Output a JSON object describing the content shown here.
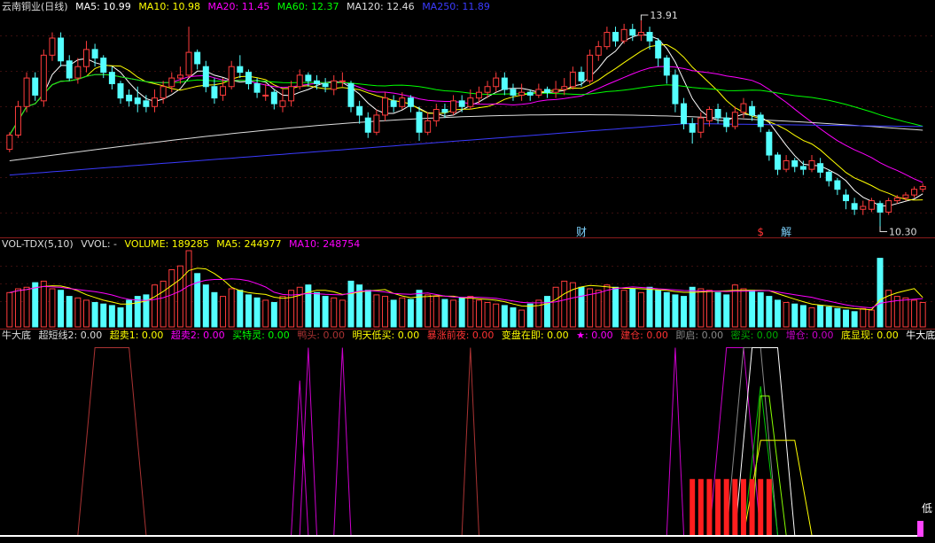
{
  "main_panel": {
    "title": "云南铜业(日线)",
    "ma_labels": [
      {
        "text": "MA5: 10.99",
        "color": "#ffffff"
      },
      {
        "text": "MA10: 10.98",
        "color": "#ffff00"
      },
      {
        "text": "MA20: 11.45",
        "color": "#ff00ff"
      },
      {
        "text": "MA60: 12.37",
        "color": "#00ff00"
      },
      {
        "text": "MA120: 12.46",
        "color": "#dddddd"
      },
      {
        "text": "MA250: 11.89",
        "color": "#3b3bff"
      }
    ],
    "high_label": "13.91",
    "low_label": "10.30",
    "event_markers": [
      {
        "text": "财",
        "color": "#7fd4ff"
      },
      {
        "text": "$",
        "color": "#ff3333"
      },
      {
        "text": "解",
        "color": "#7fd4ff"
      }
    ]
  },
  "volume_panel": {
    "labels": [
      {
        "text": "VOL-TDX(5,10)",
        "color": "#dddddd"
      },
      {
        "text": "VVOL: -",
        "color": "#dddddd"
      },
      {
        "text": "VOLUME: 189285",
        "color": "#ffff00"
      },
      {
        "text": "MA5: 244977",
        "color": "#ffff00"
      },
      {
        "text": "MA10: 248754",
        "color": "#ff00ff"
      }
    ]
  },
  "indicator_panel": {
    "labels": [
      {
        "text": "牛大底",
        "color": "#dddddd"
      },
      {
        "text": "超短线2: 0.00",
        "color": "#dddddd"
      },
      {
        "text": "超卖1: 0.00",
        "color": "#ffff00"
      },
      {
        "text": "超卖2: 0.00",
        "color": "#ff00ff"
      },
      {
        "text": "买特灵: 0.00",
        "color": "#00ff00"
      },
      {
        "text": "鸭头: 0.00",
        "color": "#aa3333"
      },
      {
        "text": "明天低买: 0.00",
        "color": "#ffff00"
      },
      {
        "text": "暴涨前夜: 0.00",
        "color": "#ff3333"
      },
      {
        "text": "变盘在即: 0.00",
        "color": "#ffff00"
      },
      {
        "text": "★: 0.00",
        "color": "#ff00ff"
      },
      {
        "text": "建仓: 0.00",
        "color": "#ff3333"
      },
      {
        "text": "即启: 0.00",
        "color": "#888888"
      },
      {
        "text": "密买: 0.00",
        "color": "#00aa00"
      },
      {
        "text": "增仓: 0.00",
        "color": "#cc00cc"
      },
      {
        "text": "底显现: 0.00",
        "color": "#ffff00"
      },
      {
        "text": "牛大底: 0.00",
        "color": "#ffffff"
      }
    ],
    "corner_label": "低"
  },
  "chart_data": {
    "type": "candlestick",
    "title": "云南铜业(日线)",
    "candles": [
      [
        11.65,
        11.9,
        11.95,
        11.6
      ],
      [
        11.9,
        12.4,
        12.5,
        11.85
      ],
      [
        12.4,
        12.9,
        13.0,
        12.3
      ],
      [
        12.9,
        12.6,
        13.0,
        12.5
      ],
      [
        12.5,
        13.3,
        13.4,
        12.4
      ],
      [
        13.3,
        13.6,
        13.7,
        13.2
      ],
      [
        13.6,
        13.2,
        13.7,
        13.1
      ],
      [
        13.2,
        12.9,
        13.3,
        12.85
      ],
      [
        12.9,
        13.1,
        13.25,
        12.8
      ],
      [
        13.1,
        13.4,
        13.55,
        13.0
      ],
      [
        13.4,
        13.25,
        13.5,
        13.1
      ],
      [
        13.25,
        13.0,
        13.3,
        12.9
      ],
      [
        13.0,
        12.8,
        13.1,
        12.7
      ],
      [
        12.8,
        12.55,
        12.85,
        12.45
      ],
      [
        12.6,
        12.5,
        12.7,
        12.4
      ],
      [
        12.55,
        12.45,
        12.75,
        12.3
      ],
      [
        12.5,
        12.4,
        12.6,
        12.3
      ],
      [
        12.4,
        12.55,
        12.7,
        12.3
      ],
      [
        12.55,
        12.75,
        12.85,
        12.45
      ],
      [
        12.75,
        12.9,
        13.0,
        12.65
      ],
      [
        12.9,
        12.95,
        13.1,
        12.8
      ],
      [
        12.95,
        13.35,
        13.8,
        12.9
      ],
      [
        13.35,
        13.15,
        13.4,
        13.05
      ],
      [
        13.1,
        12.75,
        13.2,
        12.65
      ],
      [
        12.75,
        12.55,
        12.9,
        12.45
      ],
      [
        12.6,
        12.75,
        12.9,
        12.5
      ],
      [
        12.75,
        13.1,
        13.2,
        12.7
      ],
      [
        13.1,
        13.0,
        13.3,
        12.9
      ],
      [
        13.0,
        12.8,
        13.05,
        12.7
      ],
      [
        12.8,
        12.65,
        12.9,
        12.55
      ],
      [
        12.6,
        12.6,
        12.8,
        12.5
      ],
      [
        12.65,
        12.45,
        12.7,
        12.35
      ],
      [
        12.4,
        12.5,
        12.7,
        12.3
      ],
      [
        12.5,
        12.75,
        12.85,
        12.4
      ],
      [
        12.75,
        12.95,
        13.05,
        12.7
      ],
      [
        12.95,
        12.85,
        13.0,
        12.75
      ],
      [
        12.85,
        12.8,
        12.95,
        12.7
      ],
      [
        12.8,
        12.75,
        12.9,
        12.65
      ],
      [
        12.7,
        12.85,
        12.95,
        12.6
      ],
      [
        12.85,
        12.85,
        13.0,
        12.75
      ],
      [
        12.8,
        12.4,
        12.85,
        12.3
      ],
      [
        12.4,
        12.25,
        12.5,
        12.1
      ],
      [
        12.2,
        11.95,
        12.3,
        11.85
      ],
      [
        11.95,
        12.25,
        12.35,
        11.9
      ],
      [
        12.25,
        12.55,
        12.65,
        12.15
      ],
      [
        12.5,
        12.4,
        12.6,
        12.3
      ],
      [
        12.4,
        12.55,
        12.65,
        12.35
      ],
      [
        12.55,
        12.4,
        12.6,
        12.3
      ],
      [
        12.3,
        11.95,
        12.4,
        11.8
      ],
      [
        11.95,
        12.15,
        12.3,
        11.9
      ],
      [
        12.15,
        12.35,
        12.45,
        12.05
      ],
      [
        12.35,
        12.3,
        12.45,
        12.2
      ],
      [
        12.3,
        12.5,
        12.6,
        12.25
      ],
      [
        12.5,
        12.4,
        12.6,
        12.3
      ],
      [
        12.4,
        12.55,
        12.7,
        12.35
      ],
      [
        12.55,
        12.65,
        12.75,
        12.45
      ],
      [
        12.65,
        12.75,
        12.85,
        12.55
      ],
      [
        12.75,
        12.9,
        13.0,
        12.65
      ],
      [
        12.9,
        12.7,
        13.0,
        12.6
      ],
      [
        12.7,
        12.6,
        12.8,
        12.5
      ],
      [
        12.6,
        12.65,
        12.8,
        12.5
      ],
      [
        12.65,
        12.6,
        12.7,
        12.5
      ],
      [
        12.6,
        12.7,
        12.8,
        12.55
      ],
      [
        12.7,
        12.65,
        12.75,
        12.55
      ],
      [
        12.65,
        12.7,
        12.85,
        12.55
      ],
      [
        12.7,
        12.75,
        12.9,
        12.6
      ],
      [
        12.75,
        13.0,
        13.1,
        12.7
      ],
      [
        13.0,
        12.85,
        13.1,
        12.75
      ],
      [
        12.85,
        13.3,
        13.4,
        12.8
      ],
      [
        13.3,
        13.45,
        13.55,
        13.2
      ],
      [
        13.45,
        13.7,
        13.8,
        13.4
      ],
      [
        13.7,
        13.55,
        13.8,
        13.45
      ],
      [
        13.55,
        13.75,
        13.85,
        13.5
      ],
      [
        13.75,
        13.65,
        13.85,
        13.55
      ],
      [
        13.65,
        13.7,
        13.91,
        13.55
      ],
      [
        13.7,
        13.55,
        13.8,
        13.4
      ],
      [
        13.55,
        13.25,
        13.6,
        13.1
      ],
      [
        13.25,
        12.95,
        13.3,
        12.8
      ],
      [
        12.95,
        12.45,
        13.05,
        12.3
      ],
      [
        12.45,
        12.1,
        12.55,
        12.0
      ],
      [
        12.1,
        11.95,
        12.2,
        11.75
      ],
      [
        11.95,
        12.2,
        12.3,
        11.85
      ],
      [
        12.15,
        12.35,
        12.4,
        12.05
      ],
      [
        12.35,
        12.2,
        12.45,
        12.1
      ],
      [
        12.2,
        12.05,
        12.3,
        11.95
      ],
      [
        12.05,
        12.3,
        12.4,
        12.0
      ],
      [
        12.3,
        12.45,
        12.55,
        12.2
      ],
      [
        12.4,
        12.25,
        12.5,
        12.15
      ],
      [
        12.25,
        12.05,
        12.3,
        11.95
      ],
      [
        11.95,
        11.55,
        12.0,
        11.45
      ],
      [
        11.55,
        11.3,
        11.6,
        11.2
      ],
      [
        11.3,
        11.45,
        11.55,
        11.25
      ],
      [
        11.45,
        11.35,
        11.5,
        11.25
      ],
      [
        11.35,
        11.3,
        11.45,
        11.2
      ],
      [
        11.3,
        11.45,
        11.55,
        11.25
      ],
      [
        11.4,
        11.25,
        11.5,
        11.15
      ],
      [
        11.25,
        11.1,
        11.3,
        11.0
      ],
      [
        11.1,
        10.95,
        11.15,
        10.85
      ],
      [
        10.85,
        10.75,
        10.95,
        10.6
      ],
      [
        10.7,
        10.6,
        10.8,
        10.5
      ],
      [
        10.6,
        10.65,
        10.75,
        10.5
      ],
      [
        10.6,
        10.75,
        10.8,
        10.55
      ],
      [
        10.7,
        10.55,
        10.75,
        10.3
      ],
      [
        10.55,
        10.75,
        10.8,
        10.5
      ],
      [
        10.75,
        10.8,
        10.85,
        10.7
      ],
      [
        10.8,
        10.85,
        10.9,
        10.75
      ],
      [
        10.85,
        10.95,
        11.0,
        10.8
      ],
      [
        10.95,
        11.0,
        11.05,
        10.9
      ]
    ],
    "price_range": [
      10.2,
      14.05
    ],
    "volume": [
      45,
      50,
      52,
      58,
      60,
      50,
      48,
      40,
      38,
      35,
      32,
      30,
      28,
      25,
      35,
      40,
      42,
      55,
      60,
      75,
      80,
      100,
      70,
      55,
      45,
      40,
      50,
      48,
      42,
      38,
      35,
      32,
      40,
      48,
      52,
      55,
      45,
      40,
      38,
      35,
      60,
      55,
      48,
      42,
      40,
      35,
      38,
      36,
      48,
      42,
      40,
      36,
      35,
      38,
      40,
      35,
      32,
      30,
      28,
      25,
      22,
      30,
      35,
      40,
      52,
      60,
      58,
      52,
      50,
      48,
      55,
      52,
      48,
      50,
      45,
      52,
      48,
      45,
      42,
      40,
      52,
      50,
      48,
      45,
      42,
      55,
      50,
      48,
      45,
      40,
      35,
      32,
      30,
      28,
      25,
      28,
      26,
      24,
      22,
      20,
      24,
      22,
      90,
      48,
      40,
      38,
      35,
      32
    ],
    "volume_range": [
      0,
      100
    ],
    "moving_averages": {
      "MA5": "#ffffff",
      "MA10": "#ffff00",
      "MA20": "#ff00ff",
      "MA60": "#00ff00",
      "MA120": "#dddddd",
      "MA250": "#3b3bff"
    }
  }
}
